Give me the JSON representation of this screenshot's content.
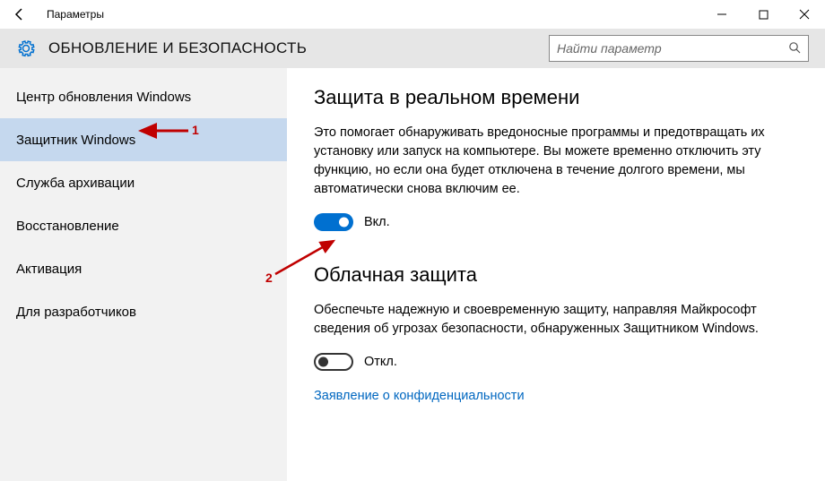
{
  "titlebar": {
    "title": "Параметры"
  },
  "header": {
    "title": "ОБНОВЛЕНИЕ И БЕЗОПАСНОСТЬ"
  },
  "search": {
    "placeholder": "Найти параметр"
  },
  "sidebar": {
    "items": [
      {
        "label": "Центр обновления Windows"
      },
      {
        "label": "Защитник Windows"
      },
      {
        "label": "Служба архивации"
      },
      {
        "label": "Восстановление"
      },
      {
        "label": "Активация"
      },
      {
        "label": "Для разработчиков"
      }
    ],
    "selectedIndex": 1
  },
  "content": {
    "section1": {
      "title": "Защита в реальном времени",
      "desc": "Это помогает обнаруживать вредоносные программы и предотвращать их установку или запуск на компьютере. Вы можете временно отключить эту функцию, но если она будет отключена в течение долгого времени, мы автоматически снова включим ее.",
      "toggle_on": true,
      "toggle_label": "Вкл."
    },
    "section2": {
      "title": "Облачная защита",
      "desc": "Обеспечьте надежную и своевременную защиту, направляя Майкрософт сведения об угрозах безопасности, обнаруженных Защитником Windows.",
      "toggle_on": false,
      "toggle_label": "Откл.",
      "link": "Заявление о конфиденциальности"
    }
  },
  "annotations": {
    "label1": "1",
    "label2": "2"
  }
}
